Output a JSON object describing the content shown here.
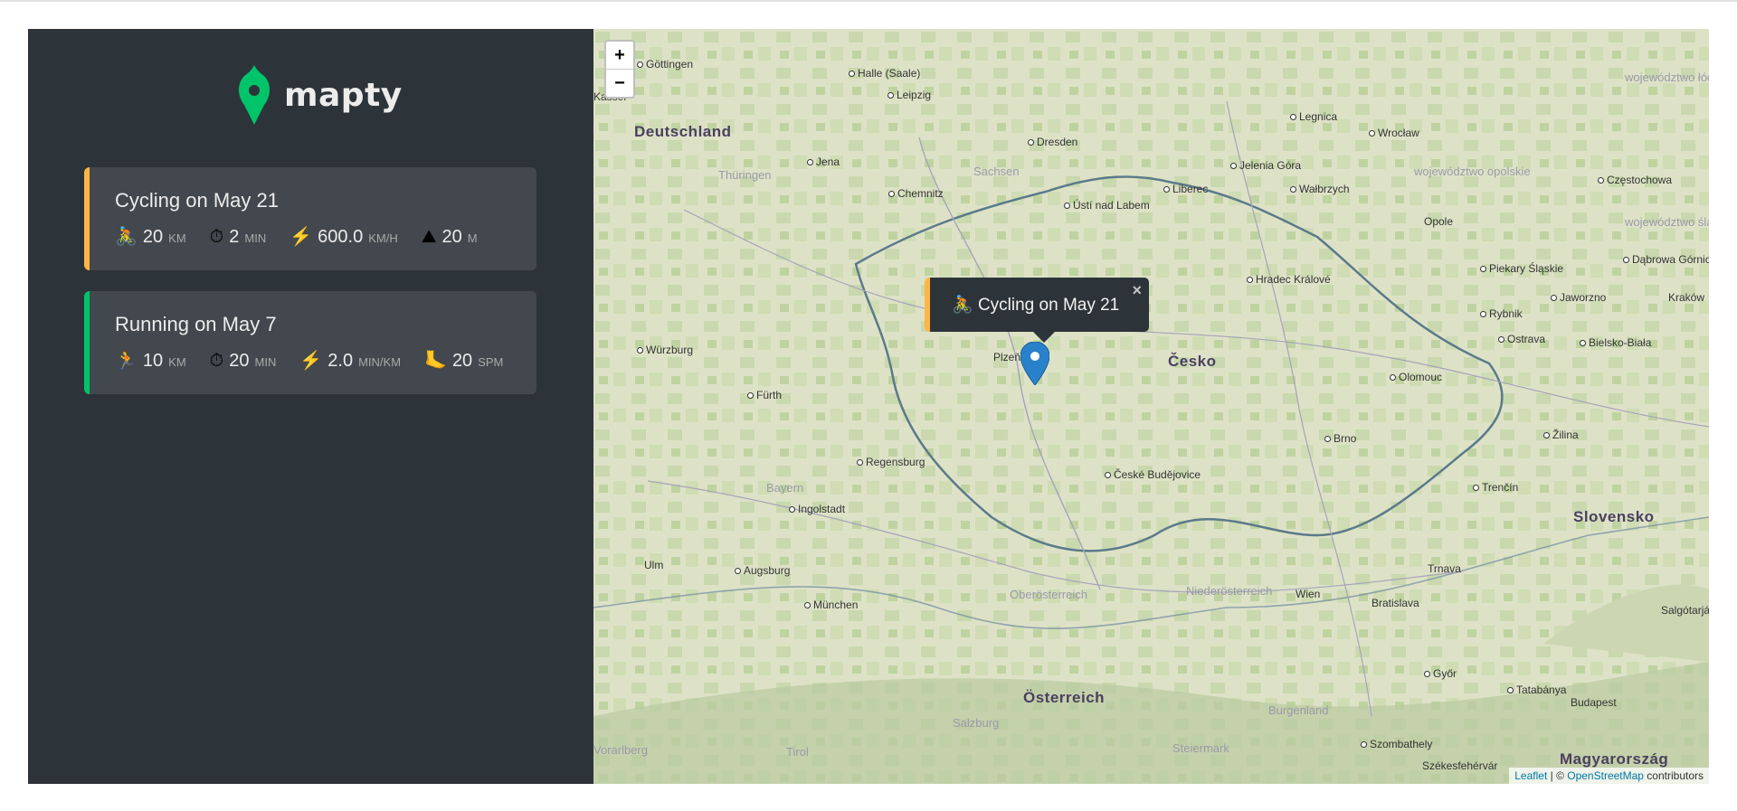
{
  "app": {
    "logo_text": "mapty",
    "colors": {
      "cycling": "#ffb545",
      "running": "#00c46a",
      "sidebar": "#2d3439",
      "card": "#42484d"
    }
  },
  "workouts": [
    {
      "title": "Cycling on May 21",
      "type": "cycling",
      "stats": [
        {
          "icon": "🚴",
          "icon_name": "cyclist-icon",
          "value": "20",
          "unit": "KM"
        },
        {
          "icon": "⏱",
          "icon_name": "stopwatch-icon",
          "value": "2",
          "unit": "MIN"
        },
        {
          "icon": "⚡",
          "icon_name": "lightning-icon",
          "value": "600.0",
          "unit": "KM/H"
        },
        {
          "icon": "⛰",
          "icon_name": "mountain-icon",
          "value": "20",
          "unit": "M"
        }
      ]
    },
    {
      "title": "Running on May 7",
      "type": "running",
      "stats": [
        {
          "icon": "🏃",
          "icon_name": "runner-icon",
          "value": "10",
          "unit": "KM"
        },
        {
          "icon": "⏱",
          "icon_name": "stopwatch-icon",
          "value": "20",
          "unit": "MIN"
        },
        {
          "icon": "⚡",
          "icon_name": "lightning-icon",
          "value": "2.0",
          "unit": "MIN/KM"
        },
        {
          "icon": "🦶",
          "icon_name": "footprint-icon",
          "value": "20",
          "unit": "SPM"
        }
      ]
    }
  ],
  "map": {
    "zoom_in": "+",
    "zoom_out": "−",
    "popup": {
      "icon": "🚴",
      "text": "Cycling on May 21",
      "close": "×"
    },
    "attribution": {
      "leaflet": "Leaflet",
      "sep": " | © ",
      "osm": "OpenStreetMap",
      "tail": " contributors"
    },
    "labels": {
      "countries": [
        "Deutschland",
        "Česko",
        "Österreich",
        "Slovensko",
        "Magyarország"
      ],
      "regions": [
        "Thüringen",
        "Sachsen",
        "Bayern",
        "Oberösterreich",
        "Niederösterreich",
        "Burgenland",
        "Steiermark",
        "Salzburg",
        "województwo opolskie",
        "województwo łódzkie",
        "województwo śląskie"
      ],
      "cities": [
        "Göttingen",
        "Halle (Saale)",
        "Leipzig",
        "Kassel",
        "Dresden",
        "Legnica",
        "Wrocław",
        "Jena",
        "Chemnitz",
        "Jelenia Góra",
        "Wałbrzych",
        "Częstochowa",
        "Ústí nad Labem",
        "Liberec",
        "Opole",
        "Würzburg",
        "Plzeň",
        "Hradec Králové",
        "Piekary Śląskie",
        "Dąbrowa Górnicza",
        "Rybnik",
        "Jaworzno",
        "Kraków",
        "Ostrava",
        "Bielsko-Biała",
        "Fürth",
        "Olomouc",
        "Regensburg",
        "Brno",
        "Žilina",
        "České Budějovice",
        "Ingolstadt",
        "Trenčín",
        "Ulm",
        "Augsburg",
        "Wien",
        "Trnava",
        "München",
        "Bratislava",
        "Salgótarján",
        "Győr",
        "Tatabánya",
        "Budapest",
        "Szombathely",
        "Székesfehérvár",
        "Vorarlberg",
        "Tirol"
      ]
    }
  }
}
